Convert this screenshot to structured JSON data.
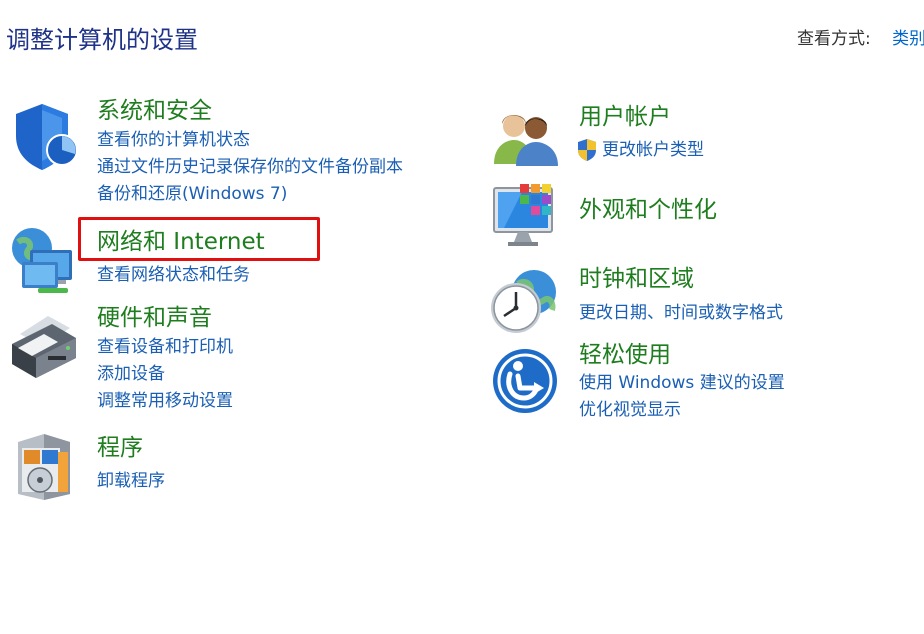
{
  "header": {
    "title": "调整计算机的设置",
    "view_by_label": "查看方式:",
    "view_by_value": "类别"
  },
  "categories": {
    "system_security": {
      "title": "系统和安全",
      "icon": "shield-icon",
      "links": [
        "查看你的计算机状态",
        "通过文件历史记录保存你的文件备份副本",
        "备份和还原(Windows 7)"
      ]
    },
    "network": {
      "title": "网络和 Internet",
      "icon": "network-icon",
      "links": [
        "查看网络状态和任务"
      ]
    },
    "hardware": {
      "title": "硬件和声音",
      "icon": "printer-icon",
      "links": [
        "查看设备和打印机",
        "添加设备",
        "调整常用移动设置"
      ]
    },
    "programs": {
      "title": "程序",
      "icon": "programs-icon",
      "links": [
        "卸载程序"
      ]
    },
    "user_accounts": {
      "title": "用户帐户",
      "icon": "users-icon",
      "links": [
        "更改帐户类型"
      ]
    },
    "appearance": {
      "title": "外观和个性化",
      "icon": "monitor-icon",
      "links": []
    },
    "clock_region": {
      "title": "时钟和区域",
      "icon": "clock-globe-icon",
      "links": [
        "更改日期、时间或数字格式"
      ]
    },
    "ease_access": {
      "title": "轻松使用",
      "icon": "ease-of-access-icon",
      "links": [
        "使用 Windows 建议的设置",
        "优化视觉显示"
      ]
    }
  },
  "colors": {
    "title": "#1e3287",
    "category": "#1e7d1e",
    "link": "#1a5fb4",
    "highlight": "#e01010"
  }
}
